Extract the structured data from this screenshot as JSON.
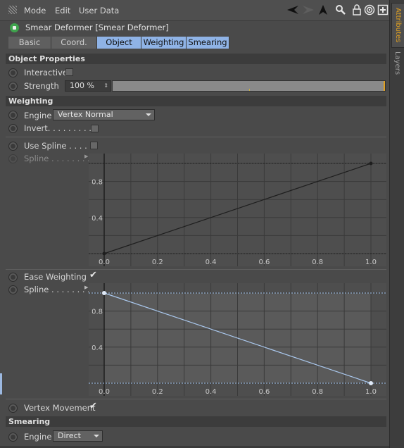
{
  "menu": {
    "items": [
      "Mode",
      "Edit",
      "User Data"
    ]
  },
  "object": {
    "title": "Smear Deformer [Smear Deformer]"
  },
  "tabs": [
    {
      "label": "Basic",
      "active": false
    },
    {
      "label": "Coord.",
      "active": false
    },
    {
      "label": "Object",
      "active": true
    },
    {
      "label": "Weighting",
      "active": true
    },
    {
      "label": "Smearing",
      "active": true
    }
  ],
  "object_properties": {
    "heading": "Object Properties",
    "interactive_label": "Interactive",
    "interactive_checked": false,
    "strength_label": "Strength",
    "strength_value": "100 %",
    "strength_fraction": 1.0
  },
  "weighting": {
    "heading": "Weighting",
    "engine_label": "Engine",
    "engine_value": "Vertex Normal",
    "invert_label": "Invert. . . . . . . . . .",
    "invert_checked": false,
    "use_spline_label": "Use Spline . . . . .",
    "use_spline_checked": false,
    "spline_label": "Spline . . . . . . . .",
    "ease_label": "Ease Weighting",
    "ease_checked": true,
    "spline2_label": "Spline . . . . . . . .",
    "vertex_movement_label": "Vertex Movement",
    "vertex_movement_checked": true
  },
  "smearing": {
    "heading": "Smearing",
    "engine_label": "Engine",
    "engine_value": "Direct"
  },
  "side_tabs": [
    "Attributes",
    "Layers"
  ],
  "chart_data": [
    {
      "type": "line",
      "x_ticks": [
        "0.0",
        "0.2",
        "0.4",
        "0.6",
        "0.8",
        "1.0"
      ],
      "y_ticks": [
        "0.4",
        "0.8"
      ],
      "xlim": [
        0,
        1
      ],
      "ylim": [
        0,
        1
      ],
      "series": [
        {
          "x": [
            0,
            1
          ],
          "y": [
            0,
            1
          ]
        }
      ],
      "line_color": "#1e1e1e",
      "active": false
    },
    {
      "type": "line",
      "x_ticks": [
        "0.0",
        "0.2",
        "0.4",
        "0.6",
        "0.8",
        "1.0"
      ],
      "y_ticks": [
        "0.4",
        "0.8"
      ],
      "xlim": [
        0,
        1
      ],
      "ylim": [
        0,
        1
      ],
      "series": [
        {
          "x": [
            0,
            1
          ],
          "y": [
            1,
            0
          ]
        }
      ],
      "line_color": "#aac8ee",
      "active": true
    }
  ],
  "colors": {
    "accent": "#8fb3e6",
    "slider_tick": "#e0a020"
  }
}
